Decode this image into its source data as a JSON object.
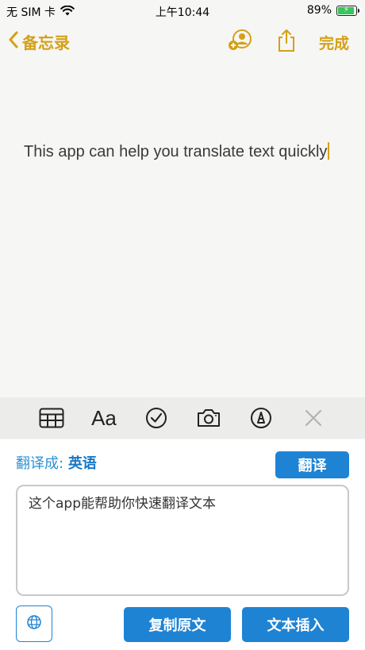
{
  "status_bar": {
    "carrier": "无 SIM 卡",
    "time": "上午10:44",
    "battery_percent": "89%",
    "battery_level": 0.89
  },
  "nav": {
    "back_label": "备忘录",
    "done_label": "完成"
  },
  "note": {
    "text": "This app can help you translate text quickly"
  },
  "tools": [
    "table-icon",
    "text-format-icon",
    "checklist-icon",
    "camera-icon",
    "markup-pen-icon",
    "close-icon"
  ],
  "tool_labels": {
    "format": "Aa"
  },
  "panel": {
    "translate_to_label": "翻译成:",
    "target_language": "英语",
    "translate_button": "翻译",
    "input_text": "这个app能帮助你快速翻译文本",
    "copy_button": "复制原文",
    "insert_button": "文本插入"
  },
  "colors": {
    "accent_notes": "#d4a017",
    "accent_blue": "#1f83d4"
  }
}
